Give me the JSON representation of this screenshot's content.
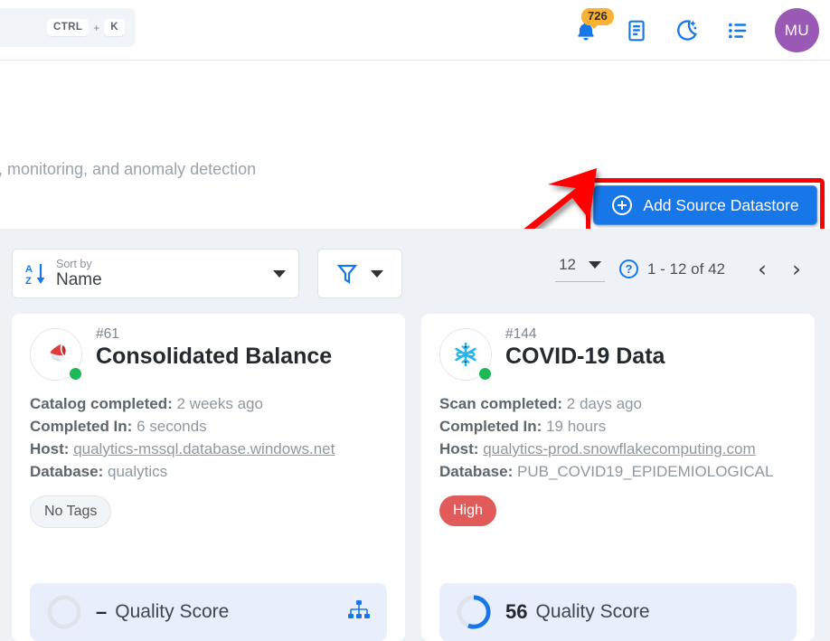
{
  "topbar": {
    "search": {
      "kbd1": "CTRL",
      "plus": "+",
      "kbd2": "K",
      "name": "search-shortcut"
    },
    "notifications": {
      "count": "726",
      "icon": "bell-icon"
    },
    "icons": [
      {
        "name": "document-icon"
      },
      {
        "name": "moon-star-icon"
      },
      {
        "name": "list-icon"
      }
    ],
    "avatar": {
      "initials": "MU"
    }
  },
  "page_head": {
    "subtitle": ", monitoring, and anomaly detection",
    "add_button": {
      "label": "Add Source Datastore",
      "icon": "plus-circle-icon"
    }
  },
  "toolbar": {
    "sort": {
      "label": "Sort by",
      "value": "Name",
      "icon": "sort-az-icon"
    },
    "filter": {
      "icon": "filter-icon"
    },
    "pagination": {
      "page_size": "12",
      "range": "1 - 12 of 42",
      "prev": "‹",
      "next": "›",
      "help": "?"
    }
  },
  "cards": [
    {
      "id": "#61",
      "name": "Consolidated Balance",
      "icon": "mssql-icon",
      "status": "online",
      "meta": [
        {
          "label": "Catalog completed:",
          "value": "2 weeks ago",
          "link": false
        },
        {
          "label": "Completed In:",
          "value": "6 seconds",
          "link": false
        },
        {
          "label": "Host:",
          "value": "qualytics-mssql.database.windows.net",
          "link": true
        },
        {
          "label": "Database:",
          "value": "qualytics",
          "link": false
        }
      ],
      "tag": {
        "text": "No Tags",
        "kind": "none"
      },
      "quality": {
        "value": "–",
        "label": "Quality Score",
        "percent": 0,
        "action_icon": "hierarchy-icon"
      }
    },
    {
      "id": "#144",
      "name": "COVID-19 Data",
      "icon": "snowflake-icon",
      "status": "online",
      "meta": [
        {
          "label": "Scan completed:",
          "value": "2 days ago",
          "link": false
        },
        {
          "label": "Completed In:",
          "value": "19 hours",
          "link": false
        },
        {
          "label": "Host:",
          "value": "qualytics-prod.snowflakecomputing.com",
          "link": true
        },
        {
          "label": "Database:",
          "value": "PUB_COVID19_EPIDEMIOLOGICAL",
          "link": false
        }
      ],
      "tag": {
        "text": "High",
        "kind": "high"
      },
      "quality": {
        "value": "56",
        "label": "Quality Score",
        "percent": 56,
        "action_icon": ""
      }
    }
  ],
  "colors": {
    "accent_blue": "#1877e8",
    "badge_orange": "#f9b233",
    "avatar_purple": "#9b59b6",
    "online_green": "#1db954",
    "tag_high_red": "#e15b5b",
    "highlight_red": "#ff0000",
    "content_bg": "#eef2f7",
    "quality_bg": "#e8eefb"
  }
}
